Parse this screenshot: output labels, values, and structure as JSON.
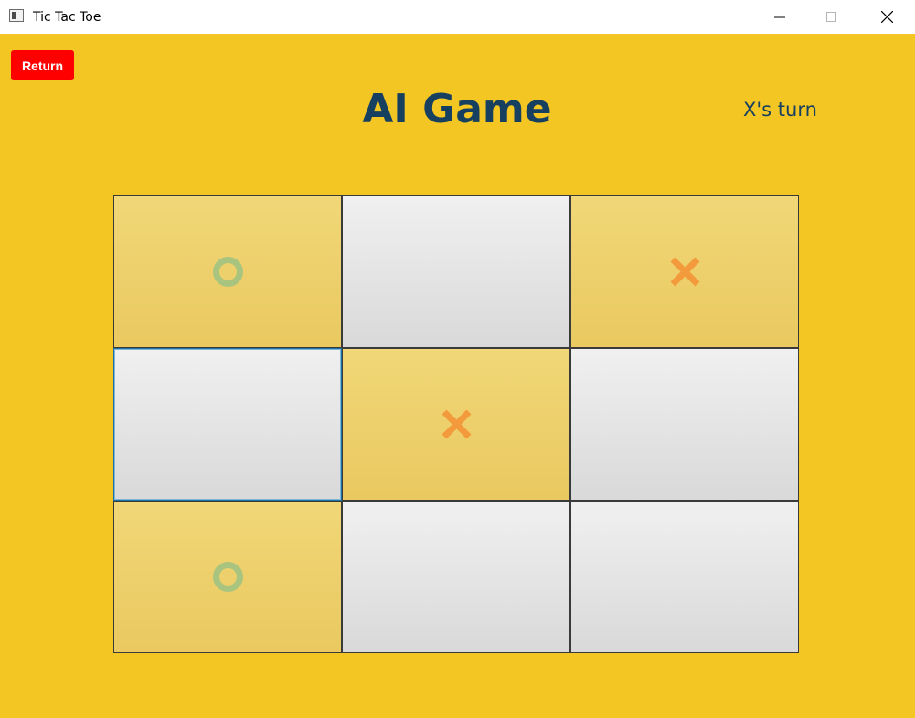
{
  "window": {
    "title": "Tic Tac Toe"
  },
  "controls": {
    "minimize": "minimize",
    "maximize": "maximize",
    "close": "close"
  },
  "header": {
    "return_label": "Return",
    "title": "AI Game",
    "turn_text": "X's turn"
  },
  "colors": {
    "background": "#f3c623",
    "title": "#173f5f",
    "return_button": "#ff0000",
    "x_mark": "#f39a3c",
    "o_mark": "#a9c47f"
  },
  "board": {
    "cells": [
      {
        "row": 1,
        "col": 1,
        "mark": "O"
      },
      {
        "row": 1,
        "col": 2,
        "mark": ""
      },
      {
        "row": 1,
        "col": 3,
        "mark": "X"
      },
      {
        "row": 2,
        "col": 1,
        "mark": "",
        "focused": true
      },
      {
        "row": 2,
        "col": 2,
        "mark": "X"
      },
      {
        "row": 2,
        "col": 3,
        "mark": ""
      },
      {
        "row": 3,
        "col": 1,
        "mark": "O"
      },
      {
        "row": 3,
        "col": 2,
        "mark": ""
      },
      {
        "row": 3,
        "col": 3,
        "mark": ""
      }
    ]
  }
}
